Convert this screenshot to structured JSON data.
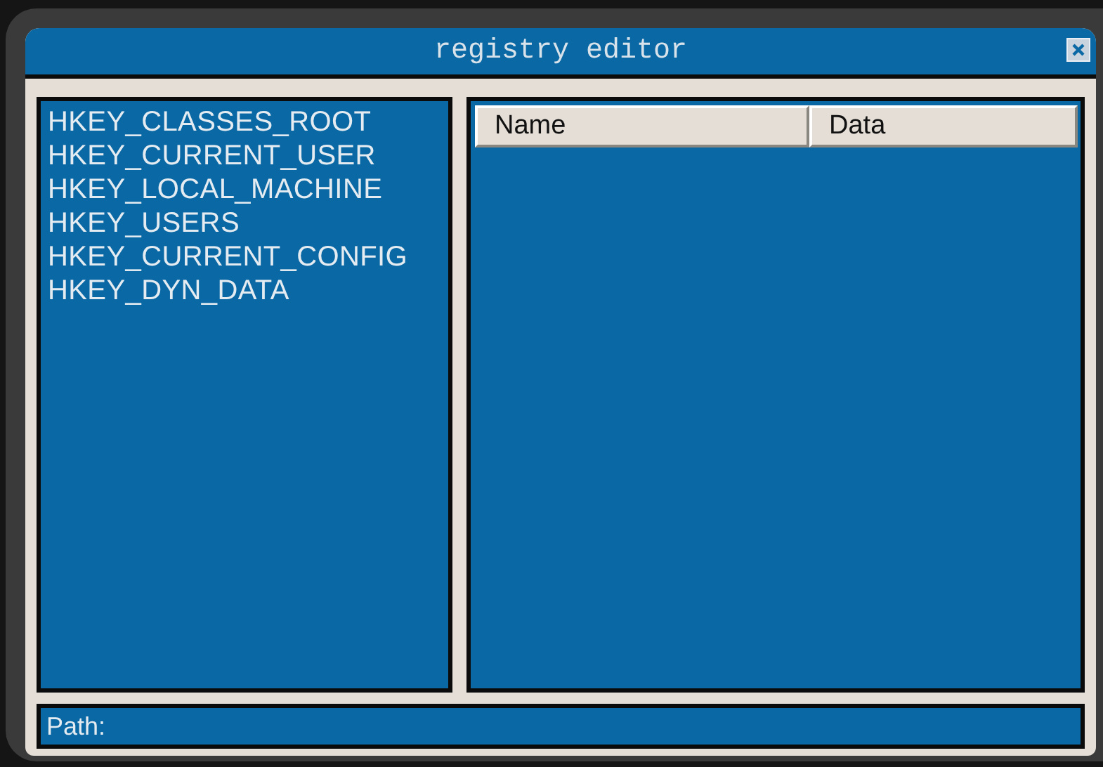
{
  "window": {
    "title": "registry editor"
  },
  "tree": {
    "items": [
      {
        "label": "HKEY_CLASSES_ROOT"
      },
      {
        "label": "HKEY_CURRENT_USER"
      },
      {
        "label": "HKEY_LOCAL_MACHINE"
      },
      {
        "label": "HKEY_USERS"
      },
      {
        "label": "HKEY_CURRENT_CONFIG"
      },
      {
        "label": "HKEY_DYN_DATA"
      }
    ]
  },
  "table": {
    "columns": [
      "Name",
      "Data"
    ]
  },
  "status_bar": {
    "label": "Path:"
  }
}
